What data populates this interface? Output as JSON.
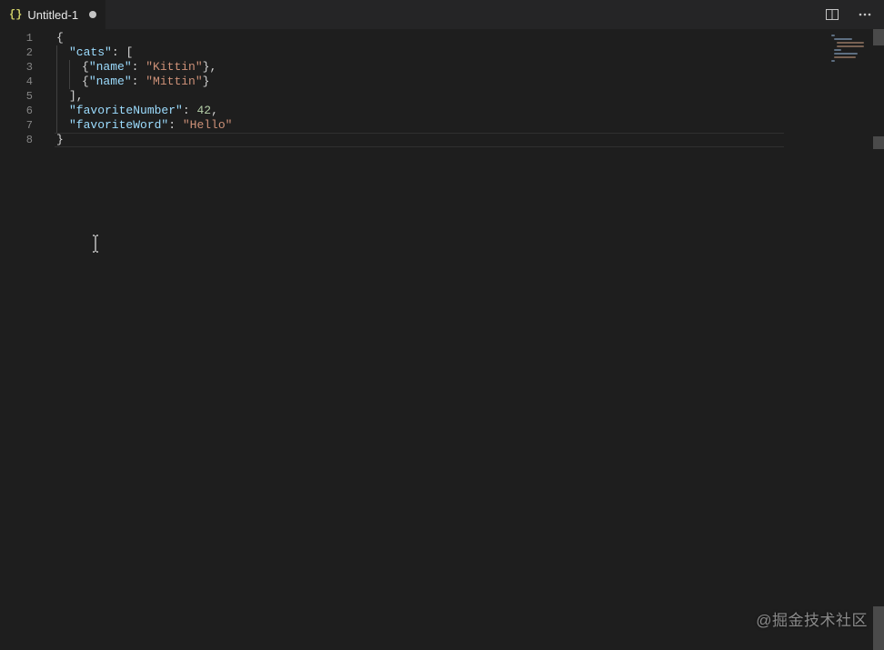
{
  "tab": {
    "title": "Untitled-1",
    "dirty": true,
    "icon": "{}"
  },
  "lineNumbers": [
    "1",
    "2",
    "3",
    "4",
    "5",
    "6",
    "7",
    "8"
  ],
  "code": {
    "l1": {
      "open": "{"
    },
    "l2": {
      "key": "\"cats\"",
      "colon": ":",
      "bracket": "["
    },
    "l3": {
      "openbr": "{",
      "key": "\"name\"",
      "colon": ":",
      "val": "\"Kittin\"",
      "close": "},"
    },
    "l4": {
      "openbr": "{",
      "key": "\"name\"",
      "colon": ":",
      "val": "\"Mittin\"",
      "close": "}"
    },
    "l5": {
      "close": "],"
    },
    "l6": {
      "key": "\"favoriteNumber\"",
      "colon": ":",
      "val": "42",
      "comma": ","
    },
    "l7": {
      "key": "\"favoriteWord\"",
      "colon": ":",
      "val": "\"Hello\""
    },
    "l8": {
      "close": "}"
    }
  },
  "watermark": "@掘金技术社区"
}
